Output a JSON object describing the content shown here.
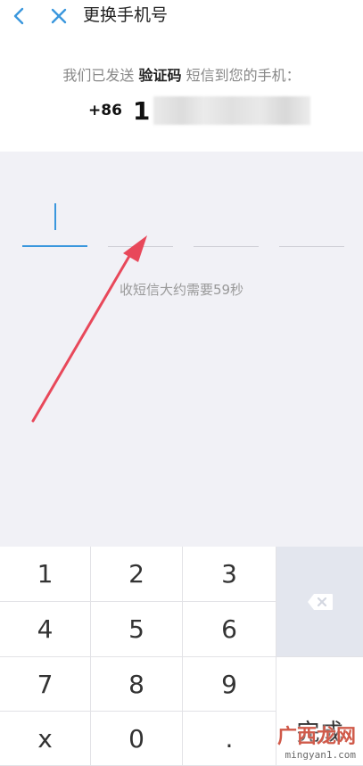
{
  "header": {
    "title": "更换手机号",
    "back_icon": "chevron-left-icon",
    "close_icon": "close-icon",
    "accent_color": "#3a97dd"
  },
  "info": {
    "sent_prefix": "我们已发送",
    "sent_keyword": "验证码",
    "sent_suffix": "短信到您的手机：",
    "country_code": "+86",
    "phone_visible": "1"
  },
  "code": {
    "slots": 4,
    "active_slot": 1,
    "countdown": "收短信大约需要59秒"
  },
  "keypad": {
    "keys": [
      "1",
      "2",
      "3",
      "4",
      "5",
      "6",
      "7",
      "8",
      "9",
      "x",
      "0",
      "."
    ],
    "delete_icon": "backspace-icon",
    "done_label": "完成"
  },
  "watermark": {
    "cn": "广西龙网",
    "url": "mingyan1.com"
  }
}
